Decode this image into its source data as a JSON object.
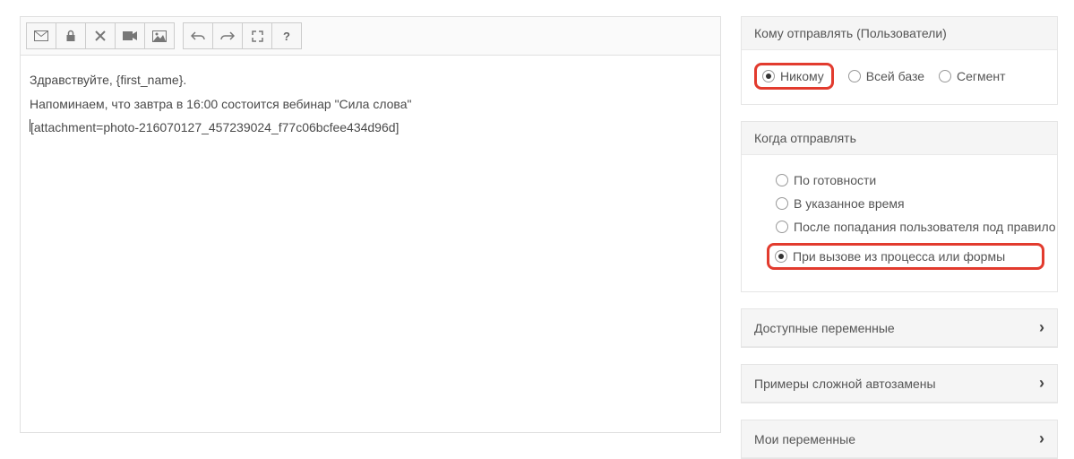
{
  "editor": {
    "toolbarIcons": [
      "email",
      "lock",
      "close",
      "video",
      "image",
      "undo",
      "redo",
      "expand",
      "help"
    ],
    "lines": [
      "Здравствуйте, {first_name}.",
      "Напоминаем, что завтра в 16:00 состоится вебинар \"Сила слова\"",
      "[attachment=photo-216070127_457239024_f77c06bcfee434d96d]"
    ]
  },
  "sidebar": {
    "recipients": {
      "title": "Кому отправлять (Пользователи)",
      "options": [
        {
          "label": "Никому",
          "selected": true,
          "highlight": true
        },
        {
          "label": "Всей базе",
          "selected": false,
          "highlight": false
        },
        {
          "label": "Сегмент",
          "selected": false,
          "highlight": false
        }
      ]
    },
    "when": {
      "title": "Когда отправлять",
      "options": [
        {
          "label": "По готовности",
          "selected": false,
          "highlight": false
        },
        {
          "label": "В указанное время",
          "selected": false,
          "highlight": false
        },
        {
          "label": "После попадания пользователя под правило",
          "selected": false,
          "highlight": false
        },
        {
          "label": "При вызове из процесса или формы",
          "selected": true,
          "highlight": true
        }
      ]
    },
    "collapsedPanels": [
      "Доступные переменные",
      "Примеры сложной автозамены",
      "Мои переменные"
    ]
  }
}
